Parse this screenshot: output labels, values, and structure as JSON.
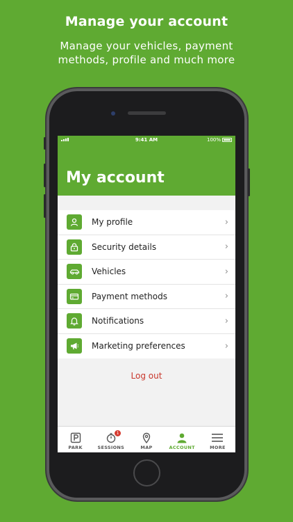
{
  "promo": {
    "headline": "Manage your account",
    "subline_1": "Manage your vehicles, payment",
    "subline_2": "methods, profile and much more"
  },
  "statusbar": {
    "time": "9:41 AM",
    "battery": "100%"
  },
  "header": {
    "title": "My account"
  },
  "menu": {
    "items": [
      {
        "label": "My profile",
        "icon": "person-icon"
      },
      {
        "label": "Security details",
        "icon": "lock-icon"
      },
      {
        "label": "Vehicles",
        "icon": "car-icon"
      },
      {
        "label": "Payment methods",
        "icon": "credit-card-icon"
      },
      {
        "label": "Notifications",
        "icon": "bell-icon"
      },
      {
        "label": "Marketing preferences",
        "icon": "megaphone-icon"
      }
    ],
    "chevron": "›"
  },
  "logout_label": "Log out",
  "tabs": [
    {
      "label": "PARK",
      "icon": "parking-icon",
      "active": false
    },
    {
      "label": "SESSIONS",
      "icon": "stopwatch-icon",
      "active": false,
      "badge": "1"
    },
    {
      "label": "MAP",
      "icon": "map-pin-icon",
      "active": false
    },
    {
      "label": "ACCOUNT",
      "icon": "account-icon",
      "active": true
    },
    {
      "label": "MORE",
      "icon": "hamburger-icon",
      "active": false
    }
  ],
  "colors": {
    "brand_green": "#5faa32",
    "logout_red": "#c8362b",
    "badge_red": "#d63a2f"
  }
}
